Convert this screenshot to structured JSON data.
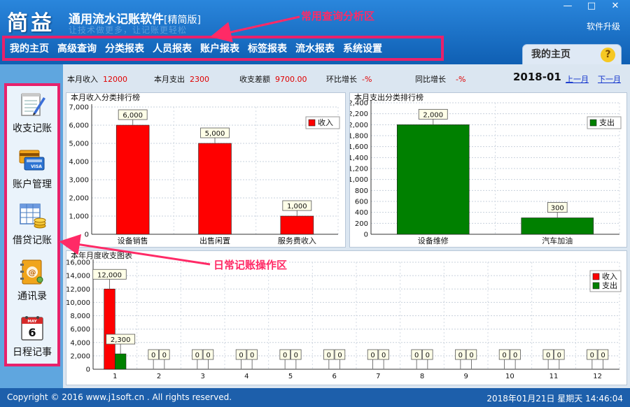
{
  "header": {
    "logo": "简益",
    "title": "通用流水记账软件",
    "edition": "[精简版]",
    "ghost_text": "让技术做更多，让记账更轻松",
    "upgrade": "软件升级",
    "window_controls": [
      "—",
      "□",
      "✕"
    ]
  },
  "annotations": {
    "top": "常用查询分析区",
    "left": "日常记账操作区"
  },
  "menu": [
    "我的主页",
    "高级查询",
    "分类报表",
    "人员报表",
    "账户报表",
    "标签报表",
    "流水报表",
    "系统设置"
  ],
  "home_tab": {
    "label": "我的主页",
    "help": "?"
  },
  "sidebar": [
    {
      "label": "收支记账",
      "icon": "notepad-icon"
    },
    {
      "label": "账户管理",
      "icon": "credit-card-icon"
    },
    {
      "label": "借贷记账",
      "icon": "spreadsheet-coins-icon"
    },
    {
      "label": "通讯录",
      "icon": "address-book-icon"
    },
    {
      "label": "日程记事",
      "icon": "calendar-icon"
    }
  ],
  "calendar_icon": {
    "month": "MAY",
    "day": "6"
  },
  "stats": {
    "income_label": "本月收入",
    "income_value": "12000",
    "expense_label": "本月支出",
    "expense_value": "2300",
    "diff_label": "收支差额",
    "diff_value": "9700.00",
    "mom_label": "环比增长",
    "mom_value": "-%",
    "yoy_label": "同比增长",
    "yoy_value": "-%",
    "month": "2018-01",
    "prev_month": "上一月",
    "next_month": "下一月"
  },
  "colors": {
    "income": "#ff0000",
    "expense": "#008000",
    "highlight_border": "#e8216b",
    "header_blue": "#1a6dc5"
  },
  "chart_data": [
    {
      "type": "bar",
      "title": "本月收入分类排行榜",
      "categories": [
        "设备销售",
        "出售闲置",
        "服务费收入"
      ],
      "series": [
        {
          "name": "收入",
          "values": [
            6000,
            5000,
            1000
          ]
        }
      ],
      "ylim": [
        0,
        7000
      ],
      "yticks": [
        0,
        1000,
        2000,
        3000,
        4000,
        5000,
        6000,
        7000
      ],
      "data_labels": [
        "6,000",
        "5,000",
        "1,000"
      ],
      "legend": "top-right",
      "grid": true
    },
    {
      "type": "bar",
      "title": "本月支出分类排行榜",
      "categories": [
        "设备维修",
        "汽车加油"
      ],
      "series": [
        {
          "name": "支出",
          "values": [
            2000,
            300
          ]
        }
      ],
      "ylim": [
        0,
        2400
      ],
      "yticks": [
        0,
        200,
        400,
        600,
        800,
        1000,
        1200,
        1400,
        1600,
        1800,
        2000,
        2200,
        2400
      ],
      "data_labels": [
        "2,000",
        "300"
      ],
      "legend": "top-right",
      "grid": true
    },
    {
      "type": "bar",
      "title": "本年月度收支图表",
      "categories": [
        "1",
        "2",
        "3",
        "4",
        "5",
        "6",
        "7",
        "8",
        "9",
        "10",
        "11",
        "12"
      ],
      "series": [
        {
          "name": "收入",
          "values": [
            12000,
            0,
            0,
            0,
            0,
            0,
            0,
            0,
            0,
            0,
            0,
            0
          ]
        },
        {
          "name": "支出",
          "values": [
            2300,
            0,
            0,
            0,
            0,
            0,
            0,
            0,
            0,
            0,
            0,
            0
          ]
        }
      ],
      "ylim": [
        0,
        16000
      ],
      "yticks": [
        0,
        2000,
        4000,
        6000,
        8000,
        10000,
        12000,
        14000,
        16000
      ],
      "legend": "top-right",
      "grid": true
    }
  ],
  "footer": {
    "copyright": "Copyright © 2016 www.j1soft.cn . All rights reserved.",
    "datetime": "2018年01月21日  星期天  14:46:04"
  }
}
